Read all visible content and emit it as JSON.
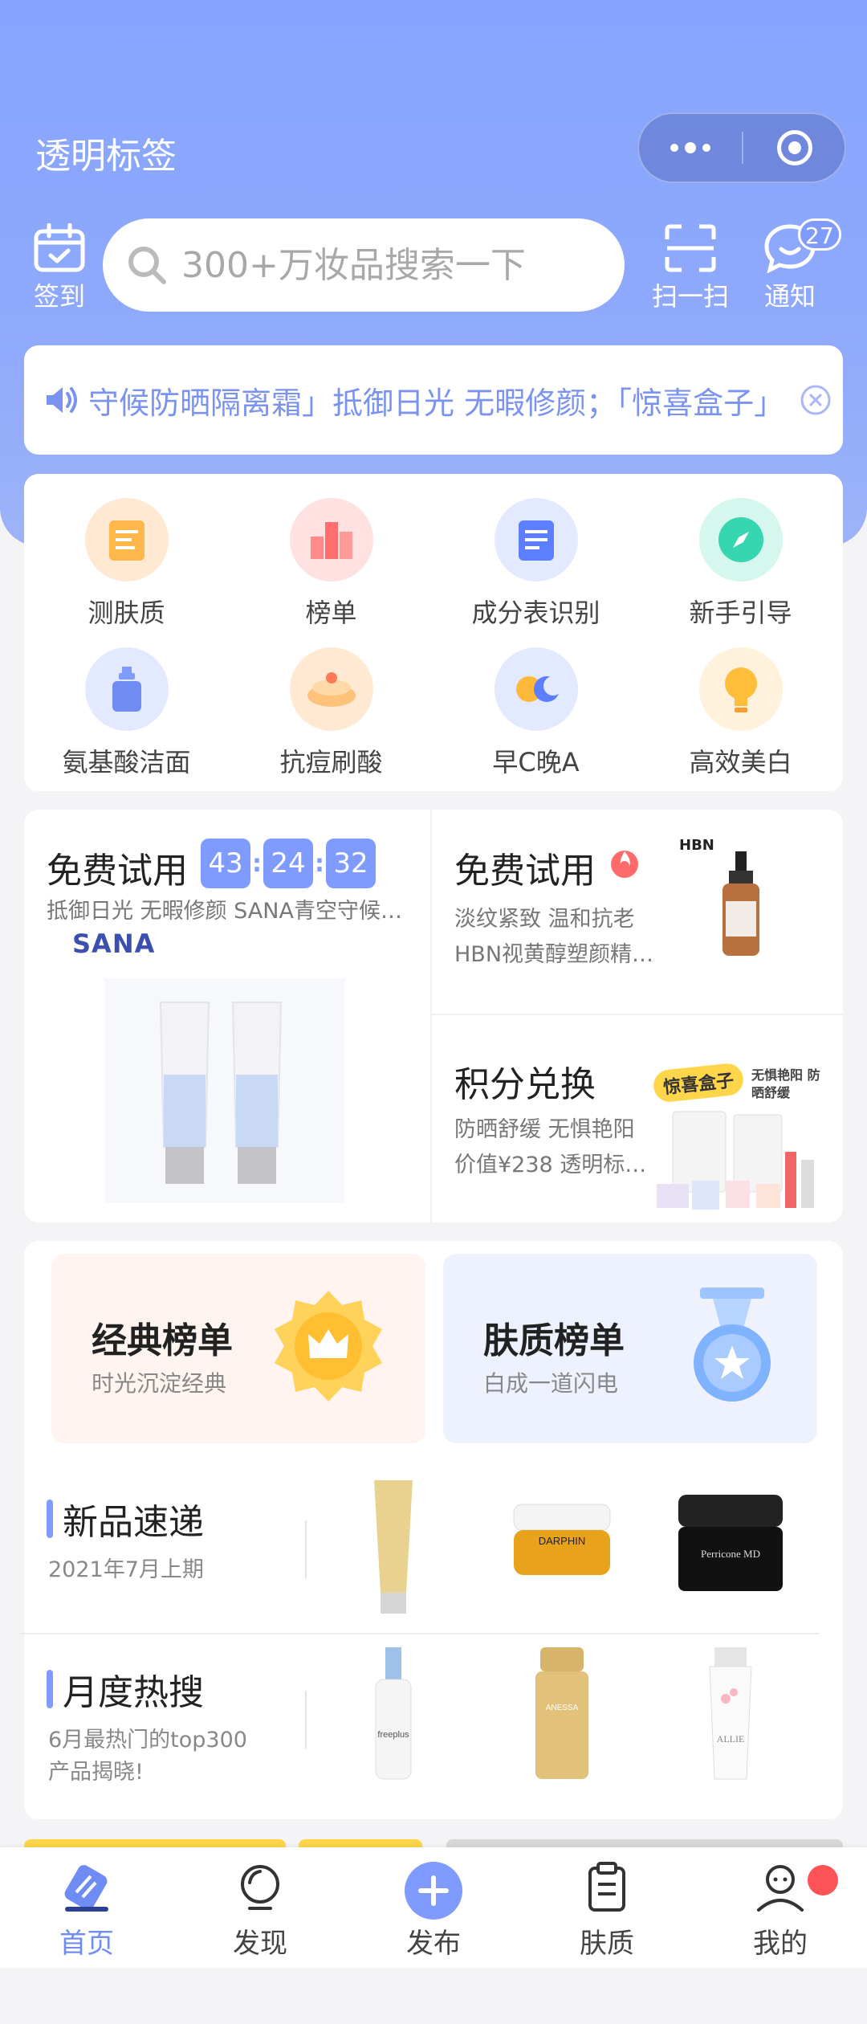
{
  "app": {
    "title": "透明标签"
  },
  "header": {
    "checkin_label": "签到",
    "search_placeholder": "300+万妆品搜索一下",
    "scan_label": "扫一扫",
    "notify_label": "通知",
    "notify_count": "27"
  },
  "notice": {
    "text": "守候防晒隔离霜」抵御日光 无暇修颜；「惊喜盒子」"
  },
  "quick_grid": [
    {
      "label": "测肤质",
      "icon": "skin-test-icon"
    },
    {
      "label": "榜单",
      "icon": "ranking-icon"
    },
    {
      "label": "成分表识别",
      "icon": "ingredient-scan-icon"
    },
    {
      "label": "新手引导",
      "icon": "compass-icon"
    },
    {
      "label": "氨基酸洁面",
      "icon": "cleanser-icon"
    },
    {
      "label": "抗痘刷酸",
      "icon": "acne-icon"
    },
    {
      "label": "早C晚A",
      "icon": "day-night-icon"
    },
    {
      "label": "高效美白",
      "icon": "bulb-icon"
    }
  ],
  "trial": {
    "left_title": "免费试用",
    "timer": [
      "43",
      "24",
      "32"
    ],
    "left_sub": "抵御日光 无暇修颜 SANA青空守候…",
    "left_brand": "SANA",
    "right_title": "免费试用",
    "right_line1": "淡纹紧致 温和抗老",
    "right_line2": "HBN视黄醇塑颜精…",
    "right_brand": "HBN",
    "points_title": "积分兑换",
    "points_line1": "防晒舒缓 无惧艳阳",
    "points_line2": "价值¥238 透明标…",
    "gift_tag": "惊喜盒子",
    "gift_tag2": "无惧艳阳 防晒舒缓"
  },
  "rankings": {
    "classic_title": "经典榜单",
    "classic_sub": "时光沉淀经典",
    "skin_title": "肤质榜单",
    "skin_sub": "白成一道闪电",
    "new_title": "新品速递",
    "new_sub": "2021年7月上期",
    "hot_title": "月度热搜",
    "hot_sub": "6月最热门的top300产品揭晓!",
    "prod_labels": [
      "DARPHIN",
      "Perricone MD",
      "freeplus",
      "ANESSA",
      "ALLIE"
    ]
  },
  "tabs": [
    {
      "label": "首页",
      "icon": "home-icon"
    },
    {
      "label": "发现",
      "icon": "discover-icon"
    },
    {
      "label": "发布",
      "icon": "plus-icon"
    },
    {
      "label": "肤质",
      "icon": "clipboard-icon"
    },
    {
      "label": "我的",
      "icon": "profile-icon"
    }
  ],
  "colors": {
    "accent": "#7f9bff",
    "hero": "#86a4ff",
    "active_tab": "#6f8cf5",
    "badge_red": "#ff5457"
  }
}
